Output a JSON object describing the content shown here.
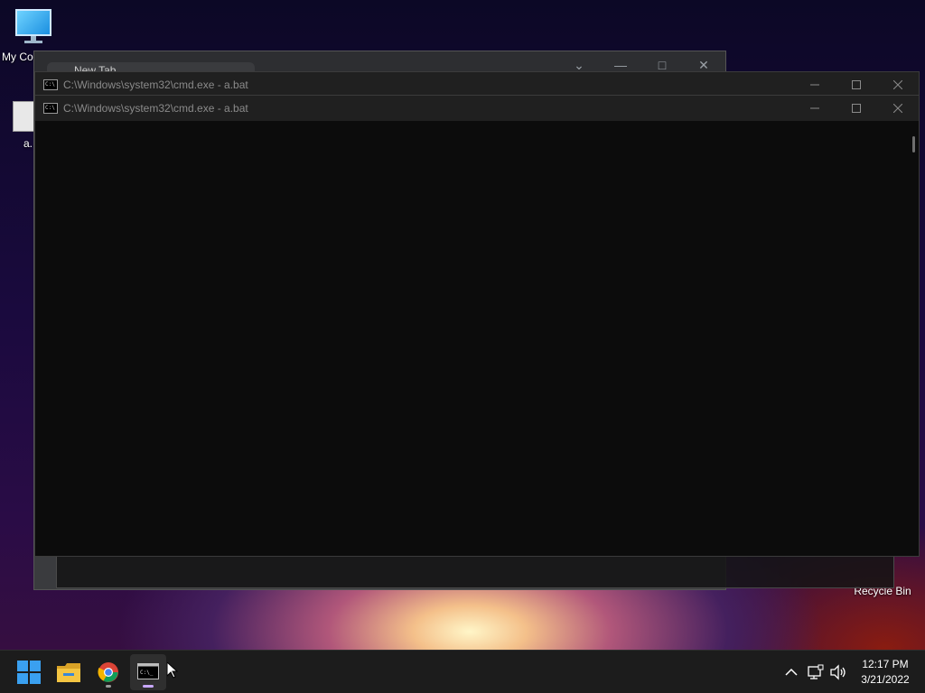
{
  "desktop": {
    "icons": [
      {
        "label": "My Co"
      },
      {
        "label": "a."
      },
      {
        "label": "Recycle Bin"
      }
    ]
  },
  "chrome": {
    "tab_label": "New Tab"
  },
  "cmd_back": {
    "title": "C:\\Windows\\system32\\cmd.exe - a.bat"
  },
  "cmd_front": {
    "title": "C:\\Windows\\system32\\cmd.exe - a.bat",
    "console_text": ""
  },
  "taskbar": {
    "clock_time": "12:17 PM",
    "clock_date": "3/21/2022",
    "items": [
      "start-icon",
      "file-explorer-icon",
      "chrome-icon",
      "cmd-icon"
    ]
  },
  "colors": {
    "taskbar_bg": "#1c1c1c",
    "titlebar_bg": "#202020",
    "console_bg": "#0c0c0c",
    "start_blue": "#3aa0f0",
    "folder_yellow": "#f4c542",
    "chrome_indicator": "#9a9a9a",
    "cmd_indicator": "#c8a8ff"
  }
}
